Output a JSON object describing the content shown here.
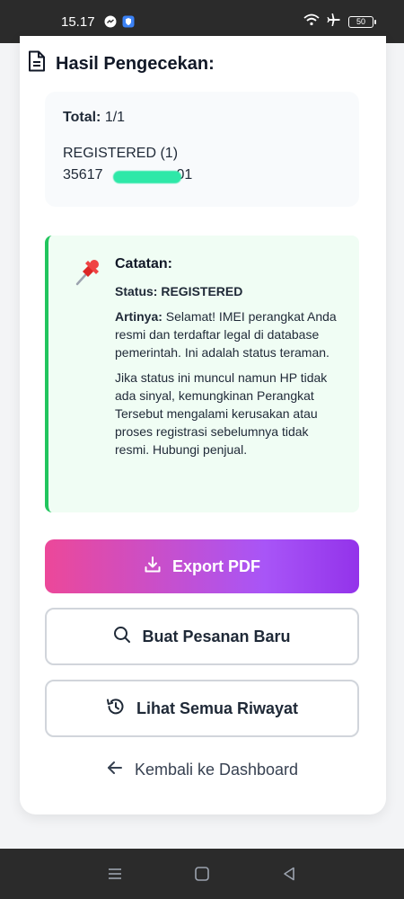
{
  "status_bar": {
    "time": "15.17",
    "battery": "50"
  },
  "result": {
    "title": "Hasil Pengecekan:",
    "total_label": "Total:",
    "total_value": "1/1",
    "status_line": "REGISTERED (1)",
    "imei_start": "35617",
    "imei_end": "01"
  },
  "note": {
    "title": "Catatan:",
    "status": "Status: REGISTERED",
    "meaning_label": "Artinya:",
    "meaning_text": " Selamat! IMEI perangkat Anda resmi dan terdaftar legal di database pemerintah. Ini adalah status teraman.",
    "extra_text": "Jika status ini muncul namun HP tidak ada sinyal, kemungkinan Perangkat Tersebut mengalami kerusakan atau proses registrasi sebelumnya tidak resmi. Hubungi penjual."
  },
  "actions": {
    "export_label": "Export PDF",
    "new_order_label": "Buat Pesanan Baru",
    "history_label": "Lihat Semua Riwayat",
    "back_label": "Kembali ke Dashboard"
  },
  "colors": {
    "accent_start": "#ec4899",
    "accent_end": "#9333ea",
    "success": "#22c55e"
  }
}
